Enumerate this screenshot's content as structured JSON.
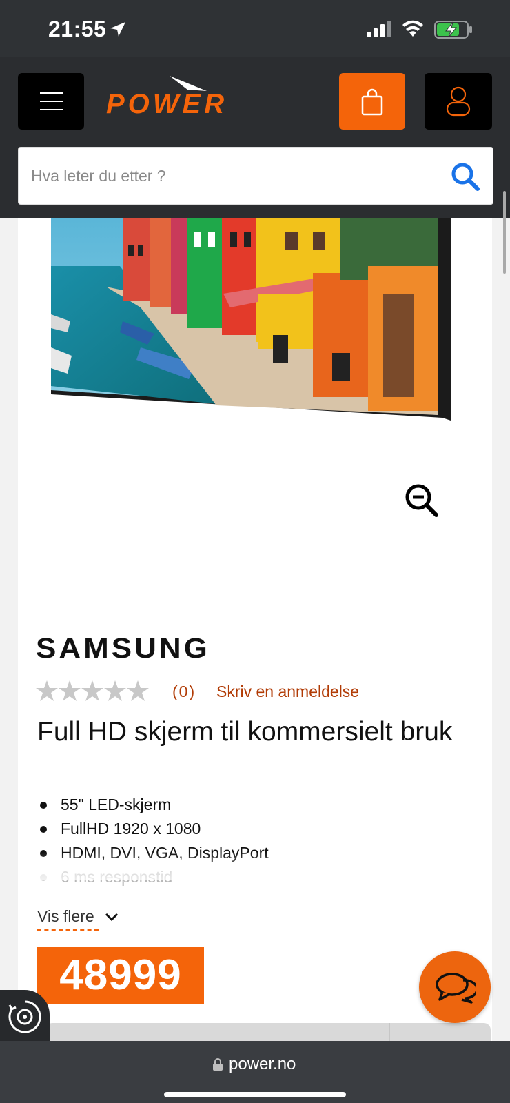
{
  "status_bar": {
    "time": "21:55"
  },
  "header": {
    "logo_text": "POWER",
    "search_placeholder": "Hva leter du etter ?"
  },
  "product": {
    "brand": "SAMSUNG",
    "rating": 0,
    "rating_max": 5,
    "review_count": "(0)",
    "write_review": "Skriv en anmeldelse",
    "title": "Full HD skjerm til kommersielt bruk",
    "features": [
      "55\" LED-skjerm",
      "FullHD 1920 x 1080",
      "HDMI, DVI, VGA, DisplayPort",
      "6 ms responstid"
    ],
    "show_more": "Vis flere",
    "price": "48999"
  },
  "browser": {
    "url": "power.no"
  },
  "colors": {
    "brand_orange": "#f4640a",
    "header_dark": "#2b2d30",
    "review_link": "#b13b05",
    "search_icon": "#1a73e8"
  },
  "icons": {
    "menu": "hamburger-icon",
    "cart": "shopping-bag-icon",
    "account": "user-icon",
    "search": "search-icon",
    "zoom": "zoom-out-icon",
    "chat": "chat-bubbles-icon",
    "accessibility": "accessibility-icon"
  }
}
